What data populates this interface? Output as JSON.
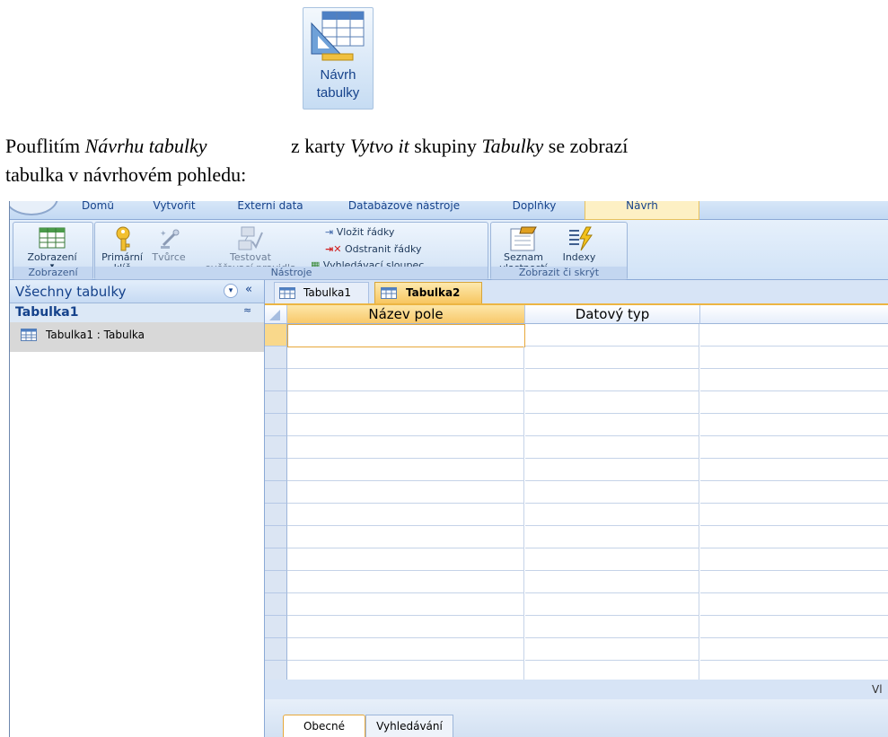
{
  "document": {
    "line1": {
      "prefix": "Pouflitím ",
      "italic1": "Návrhu tabulky",
      "middle": " z karty ",
      "italic2": "Vytvo  it",
      "middle2": " skupiny ",
      "italic3": "Tabulky",
      "suffix": " se zobrazí"
    },
    "line2": "tabulka v návrhovém pohledu:",
    "inline_button_label_1": "Návrh",
    "inline_button_label_2": "tabulky"
  },
  "ribbon": {
    "tabs": [
      "Domů",
      "Vytvořit",
      "Externí data",
      "Databázové nástroje",
      "Doplňky",
      "Návrh"
    ],
    "active_tab": "Návrh",
    "groups": {
      "zobrazeni": {
        "label": "Zobrazení",
        "button": "Zobrazení",
        "dropdown_glyph": "▾"
      },
      "nastroje": {
        "label": "Nástroje",
        "primary_key_line1": "Primární",
        "primary_key_line2": "klíč",
        "builder": "Tvůrce",
        "test_rules_line1": "Testovat",
        "test_rules_line2": "ověřovací pravidla",
        "insert_rows": "Vložit řádky",
        "delete_rows": "Odstranit řádky",
        "lookup_column": "Vyhledávací sloupec"
      },
      "zobrazit": {
        "label": "Zobrazit či skrýt",
        "property_sheet_line1": "Seznam",
        "property_sheet_line2": "vlastností",
        "indexes": "Indexy"
      }
    }
  },
  "nav": {
    "title": "Všechny tabulky",
    "group": "Tabulka1",
    "item": "Tabulka1 : Tabulka",
    "collapse_glyph": "«",
    "menu_glyph": "▾",
    "group_toggle_glyph": "≈"
  },
  "doc_tabs": [
    "Tabulka1",
    "Tabulka2"
  ],
  "active_doc_tab": "Tabulka2",
  "grid": {
    "columns": [
      "Název pole",
      "Datový typ",
      ""
    ]
  },
  "status_text": "Vl",
  "property_tabs": [
    "Obecné",
    "Vyhledávání"
  ],
  "colors": {
    "ribbon_blue": "#d1e3f7",
    "active_tab": "#fdf0c4",
    "accent_orange": "#ecb543",
    "text_blue": "#15428b"
  }
}
